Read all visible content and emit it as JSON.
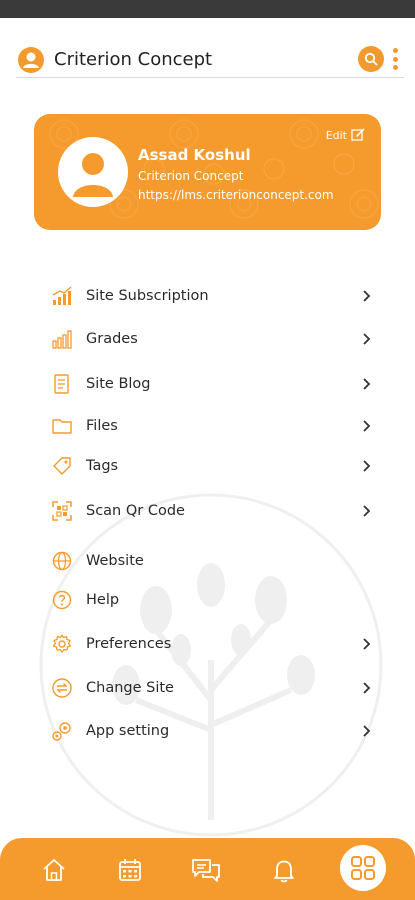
{
  "header": {
    "title": "Criterion Concept",
    "avatar_icon": "user-circle-icon",
    "search_icon": "search-icon",
    "menu_icon": "kebab-menu-icon"
  },
  "profile": {
    "name": "Assad Koshul",
    "organization": "Criterion Concept",
    "url": "https://lms.criterionconcept.com",
    "edit_label": "Edit",
    "avatar_icon": "user-avatar-icon"
  },
  "menu": {
    "items": [
      {
        "label": "Site Subscription",
        "icon": "chart-up-icon",
        "chevron": true
      },
      {
        "label": "Grades",
        "icon": "bar-chart-icon",
        "chevron": true
      },
      {
        "label": "Site Blog",
        "icon": "blog-document-icon",
        "chevron": true
      },
      {
        "label": "Files",
        "icon": "folder-icon",
        "chevron": true
      },
      {
        "label": "Tags",
        "icon": "tag-icon",
        "chevron": true
      },
      {
        "label": "Scan Qr Code",
        "icon": "scan-qr-icon",
        "chevron": true
      },
      {
        "label": "Website",
        "icon": "globe-icon",
        "chevron": false
      },
      {
        "label": "Help",
        "icon": "help-icon",
        "chevron": false
      },
      {
        "label": "Preferences",
        "icon": "gear-icon",
        "chevron": true
      },
      {
        "label": "Change Site",
        "icon": "swap-icon",
        "chevron": true
      },
      {
        "label": "App setting",
        "icon": "gears-icon",
        "chevron": true
      }
    ]
  },
  "bottom_nav": {
    "items": [
      {
        "icon": "home-icon"
      },
      {
        "icon": "calendar-icon"
      },
      {
        "icon": "messages-icon"
      },
      {
        "icon": "bell-icon"
      },
      {
        "icon": "grid-icon",
        "active": true
      }
    ]
  },
  "colors": {
    "accent": "#f59a2c",
    "status_bar": "#3a3a3a",
    "text": "#2a2a2a"
  }
}
